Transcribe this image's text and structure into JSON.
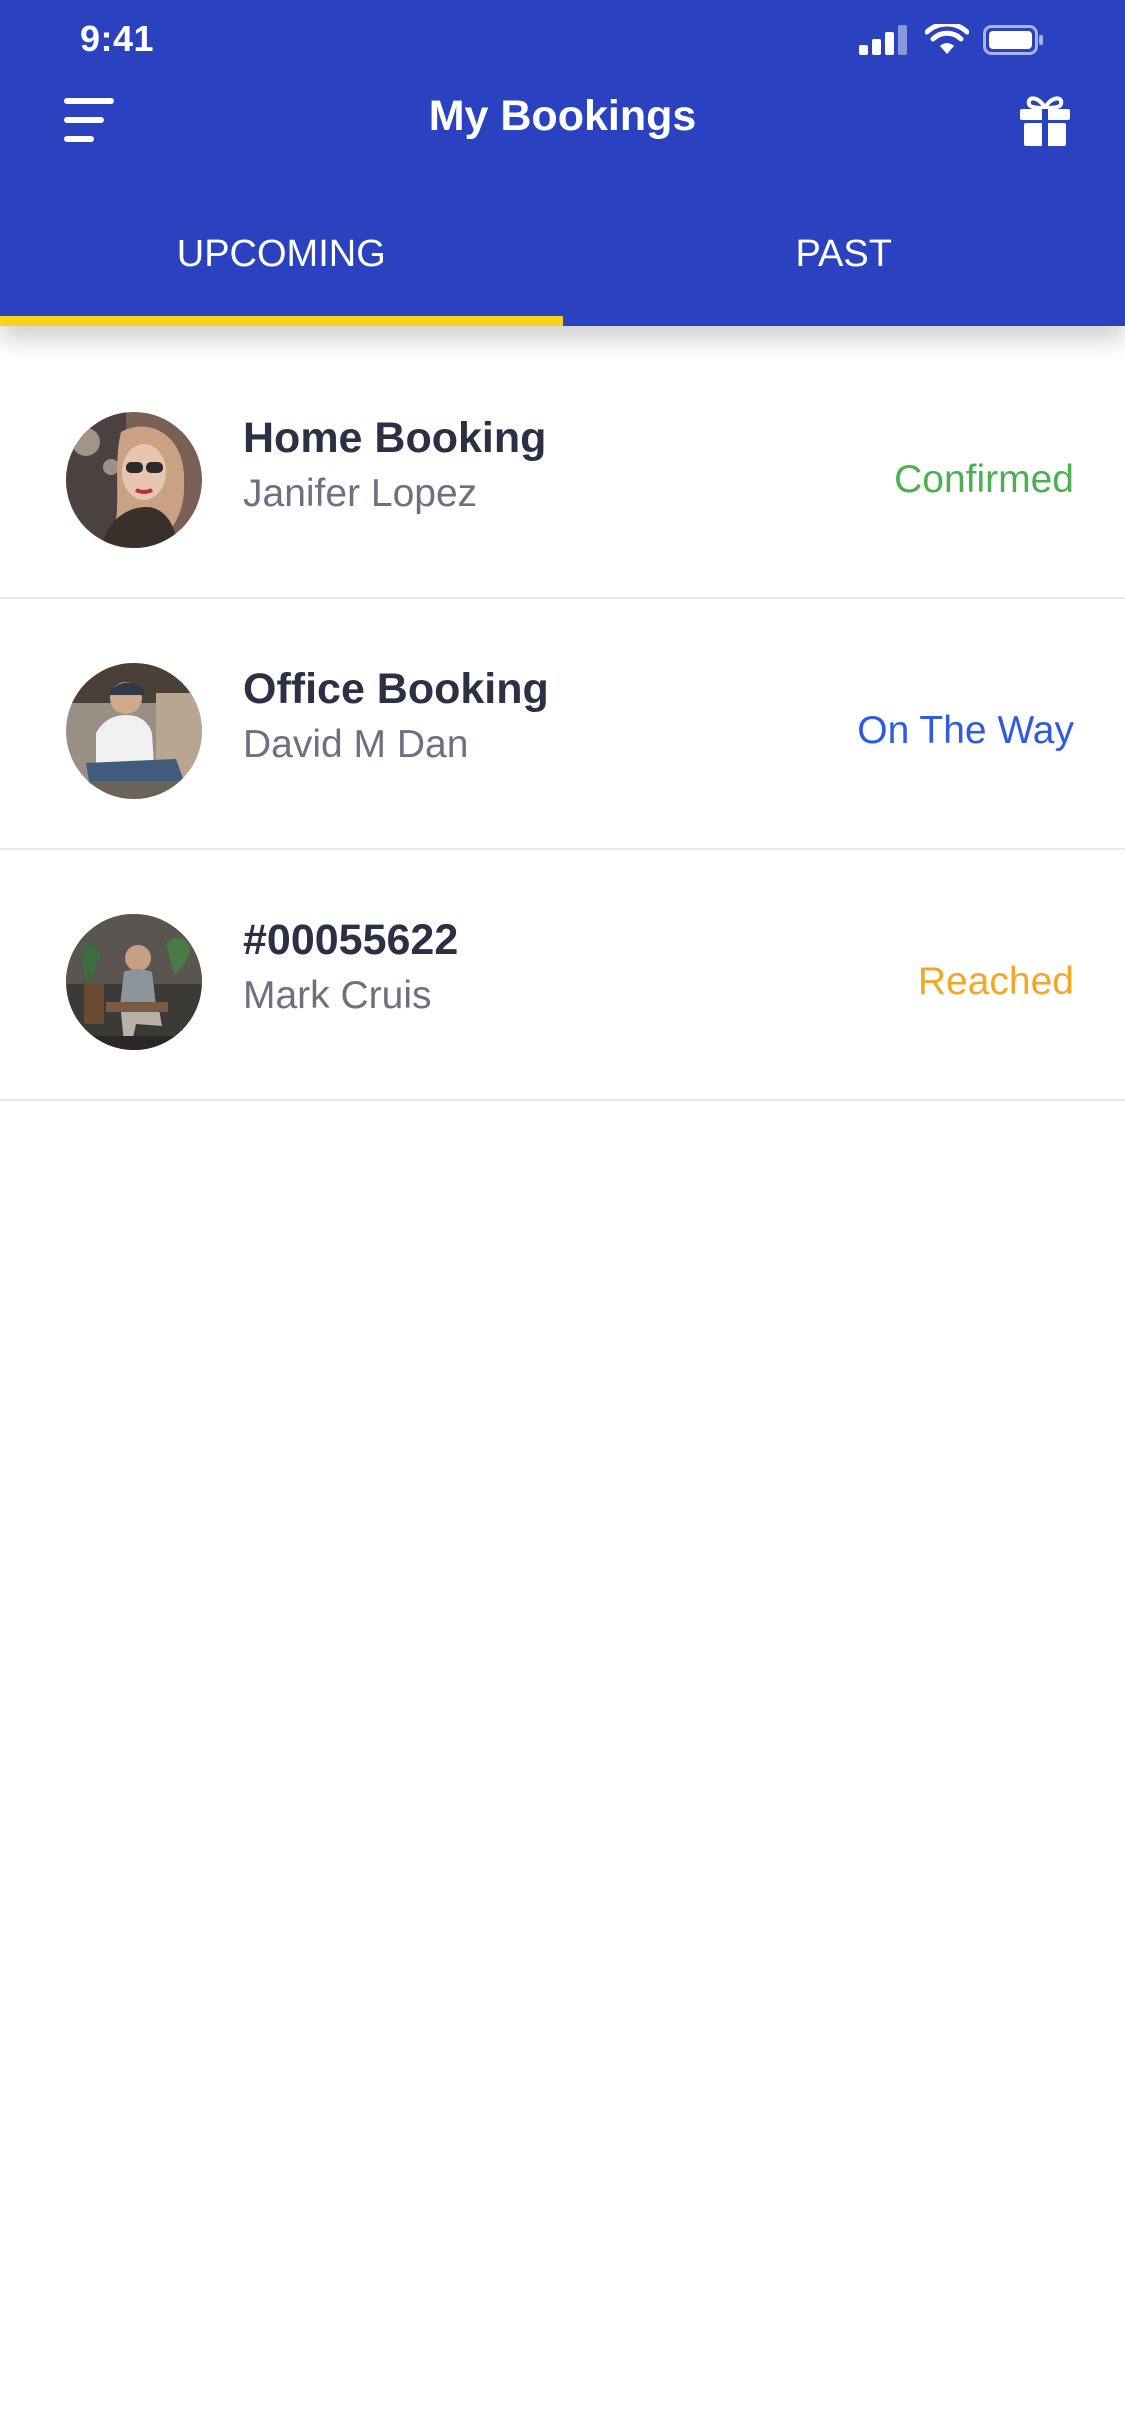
{
  "status_bar": {
    "time": "9:41"
  },
  "header": {
    "title": "My Bookings",
    "menu_icon": "menu-icon",
    "gift_icon": "gift-icon"
  },
  "tabs": [
    {
      "label": "UPCOMING",
      "active": true
    },
    {
      "label": "PAST",
      "active": false
    }
  ],
  "bookings": [
    {
      "title": "Home Booking",
      "person": "Janifer Lopez",
      "status": "Confirmed",
      "status_color": "#4caf50"
    },
    {
      "title": "Office Booking",
      "person": "David M Dan",
      "status": "On The Way",
      "status_color": "#2d5be3"
    },
    {
      "title": "#00055622",
      "person": "Mark Cruis",
      "status": "Reached",
      "status_color": "#f2a825"
    }
  ],
  "colors": {
    "header_bg": "#2b42c0",
    "tab_indicator": "#f7d21b"
  }
}
